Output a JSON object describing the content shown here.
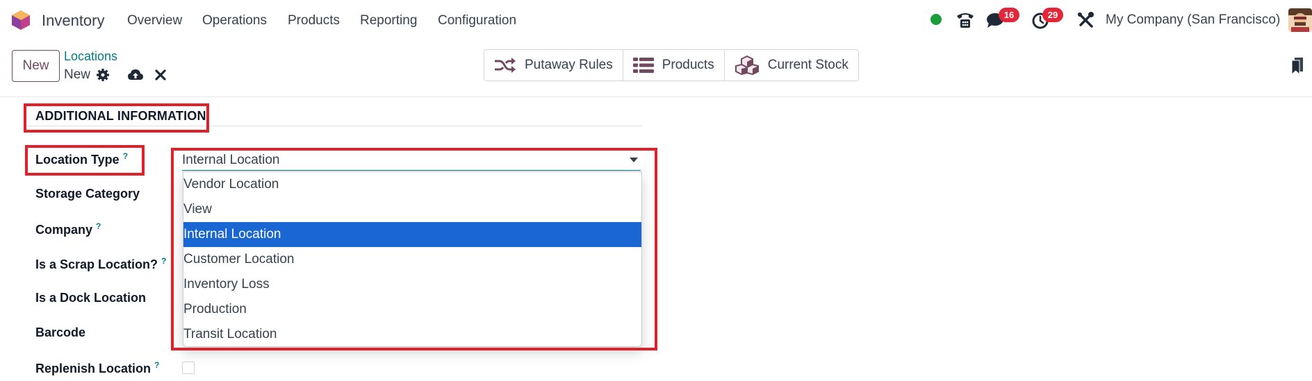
{
  "navbar": {
    "app_name": "Inventory",
    "menu": [
      "Overview",
      "Operations",
      "Products",
      "Reporting",
      "Configuration"
    ],
    "messages_count": "16",
    "activities_count": "29",
    "company": "My Company (San Francisco)"
  },
  "control": {
    "new_label": "New",
    "breadcrumb": "Locations",
    "record_name": "New",
    "smart_buttons": [
      "Putaway Rules",
      "Products",
      "Current Stock"
    ]
  },
  "form": {
    "section_title": "ADDITIONAL INFORMATION",
    "labels": {
      "location_type": "Location Type",
      "storage_category": "Storage Category",
      "company": "Company",
      "scrap": "Is a Scrap Location?",
      "dock": "Is a Dock Location",
      "barcode": "Barcode",
      "replenish": "Replenish Location"
    },
    "help_marker": "?",
    "location_type_value": "Internal Location",
    "location_type_options": [
      "Vendor Location",
      "View",
      "Internal Location",
      "Customer Location",
      "Inventory Loss",
      "Production",
      "Transit Location"
    ],
    "selected_option": "Internal Location"
  },
  "colors": {
    "brand": "#71495f",
    "link": "#017e84",
    "selection": "#1a66d2",
    "badge": "#e3273a",
    "highlight": "#e0202a",
    "online": "#1a9e3a"
  }
}
